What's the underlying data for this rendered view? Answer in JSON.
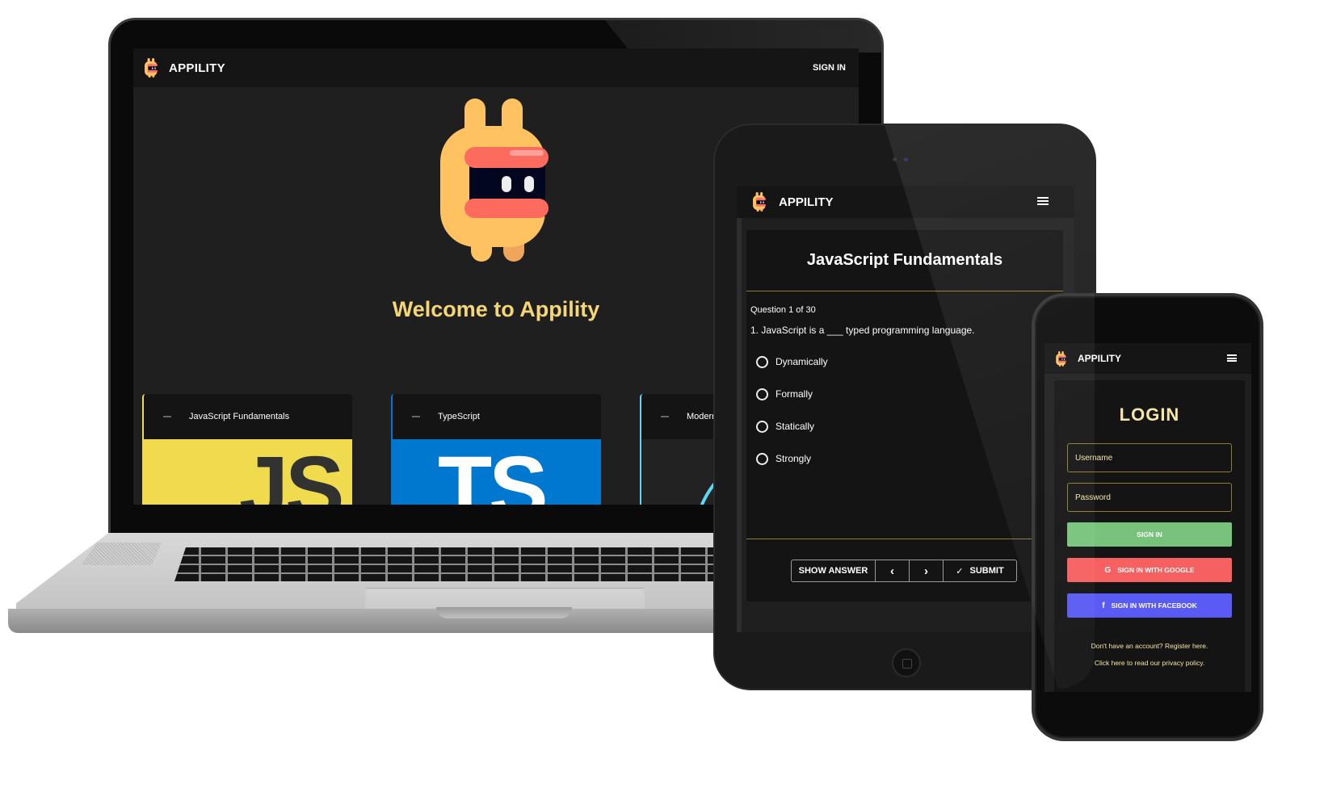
{
  "brand": {
    "name": "APPILITY",
    "logo_icon": "appility-mascot-icon"
  },
  "colors": {
    "accent_yellow": "#f4d774",
    "js_yellow": "#f0db4f",
    "ts_blue": "#0078cf",
    "modern_cyan": "#5ad8f5",
    "sign_in_green": "#77c37b",
    "google_red": "#f76060",
    "facebook_blue": "#5a5af5",
    "divider_gold": "#8c7a3a"
  },
  "laptop": {
    "header": {
      "brand": "APPILITY",
      "sign_in_label": "SIGN IN"
    },
    "welcome_title": "Welcome to Appility",
    "courses": [
      {
        "title": "JavaScript Fundamentals",
        "image_text": "JS"
      },
      {
        "title": "TypeScript",
        "image_text": "TS"
      },
      {
        "title": "Modern",
        "image_text": ""
      }
    ]
  },
  "tablet": {
    "header": {
      "brand": "APPILITY",
      "menu_icon": "hamburger-menu-icon"
    },
    "quiz": {
      "title": "JavaScript Fundamentals",
      "question_counter": "Question 1 of 30",
      "question": "1.  JavaScript is a ___ typed programming language.",
      "options": [
        "Dynamically",
        "Formally",
        "Statically",
        "Strongly"
      ],
      "buttons": {
        "show_answer": "SHOW ANSWER",
        "prev": "‹",
        "next": "›",
        "submit": "SUBMIT",
        "submit_icon": "✓"
      }
    }
  },
  "phone": {
    "header": {
      "brand": "APPILITY",
      "menu_icon": "hamburger-menu-icon"
    },
    "login": {
      "title": "LOGIN",
      "username_placeholder": "Username",
      "password_placeholder": "Password",
      "sign_in": "SIGN IN",
      "google": "SIGN IN WITH GOOGLE",
      "google_icon": "G",
      "facebook": "SIGN IN WITH FACEBOOK",
      "facebook_icon": "f",
      "register_text": "Don't have an account? Register here.",
      "privacy_text": "Click here to read our privacy policy."
    }
  }
}
